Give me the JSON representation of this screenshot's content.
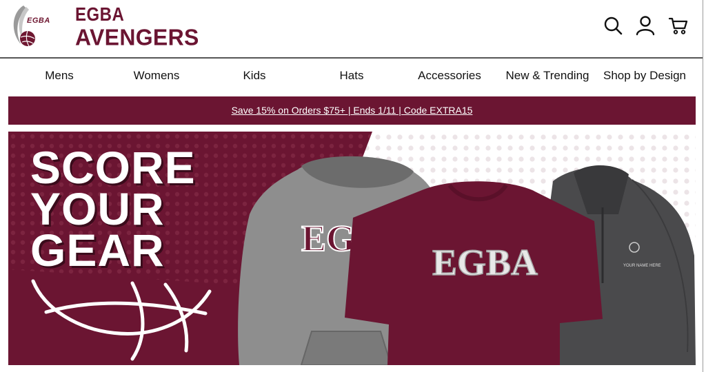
{
  "brand": {
    "logo_text": "EGBA",
    "name_line1": "EGBA",
    "name_line2": "AVENGERS",
    "color": "#6b1532"
  },
  "header_icons": [
    "search-icon",
    "account-icon",
    "cart-icon"
  ],
  "nav": {
    "items": [
      {
        "label": "Mens"
      },
      {
        "label": "Womens"
      },
      {
        "label": "Kids"
      },
      {
        "label": "Hats"
      },
      {
        "label": "Accessories"
      },
      {
        "label": "New & Trending"
      },
      {
        "label": "Shop by Design"
      }
    ]
  },
  "promo": {
    "text": "Save 15% on Orders $75+ | Ends 1/11 | Code EXTRA15"
  },
  "hero": {
    "title_lines": [
      "SCORE",
      "YOUR",
      "GEAR"
    ],
    "hoodie_text": "EGBA",
    "tshirt_text": "EGBA",
    "jacket_text": "YOUR NAME HERE"
  },
  "colors": {
    "maroon": "#6b1532",
    "gray_hoodie": "#8e8e8e",
    "charcoal": "#4a4a4c"
  }
}
